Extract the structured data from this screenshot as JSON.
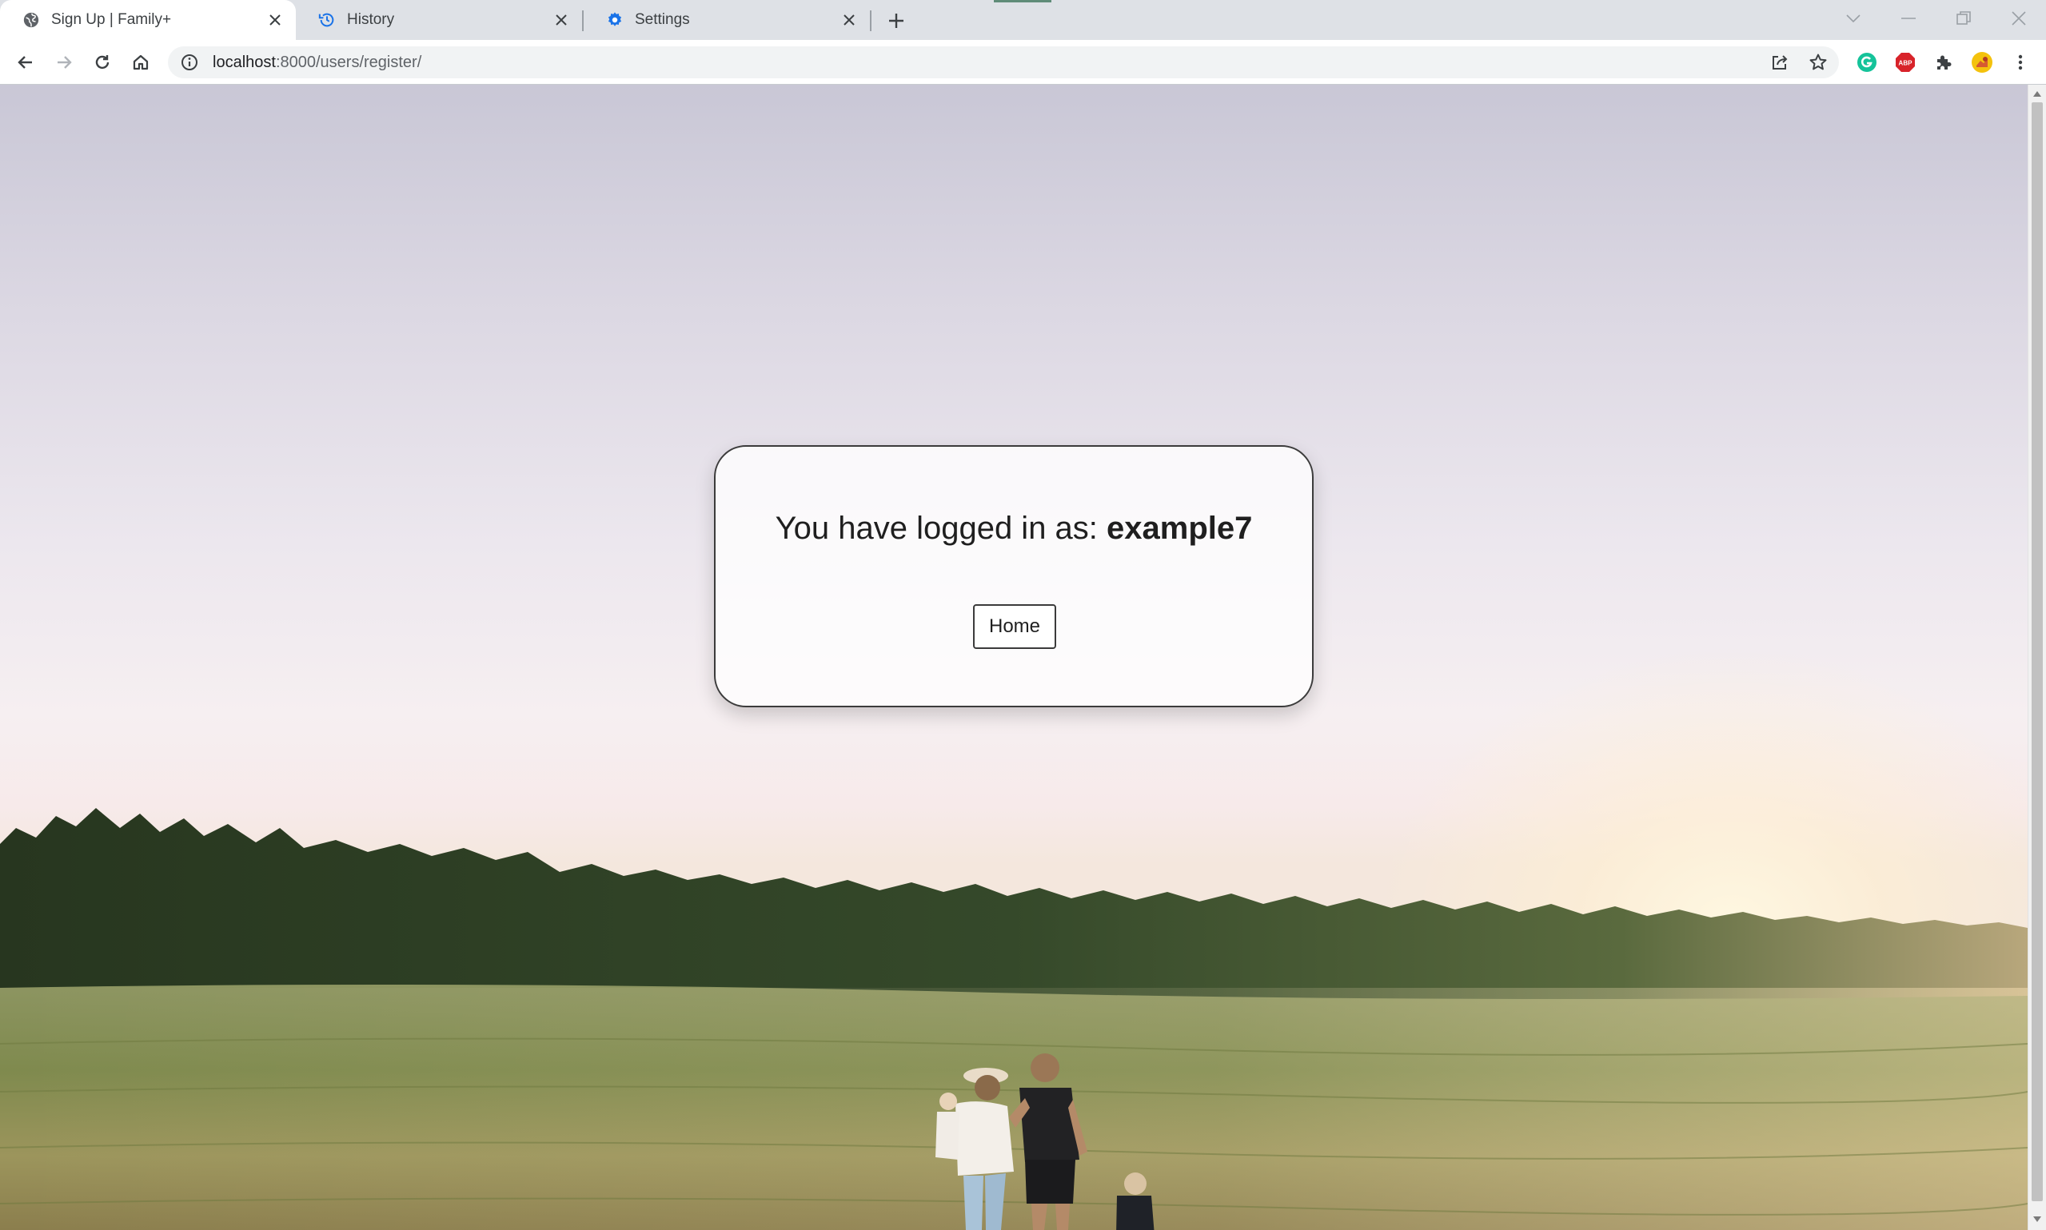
{
  "browser": {
    "tabs": [
      {
        "title": "Sign Up | Family+",
        "icon": "globe-icon",
        "active": true
      },
      {
        "title": "History",
        "icon": "history-icon",
        "active": false
      },
      {
        "title": "Settings",
        "icon": "gear-icon",
        "active": false
      }
    ],
    "url_host": "localhost",
    "url_rest": ":8000/users/register/",
    "colors": {
      "tabstrip": "#dee1e6",
      "history_icon": "#1a73e8",
      "settings_icon": "#1a73e8",
      "grammarly": "#15c39a",
      "abp": "#d8232a"
    }
  },
  "page": {
    "message_prefix": "You have logged in as:",
    "username": "example7",
    "home_button_label": "Home"
  }
}
